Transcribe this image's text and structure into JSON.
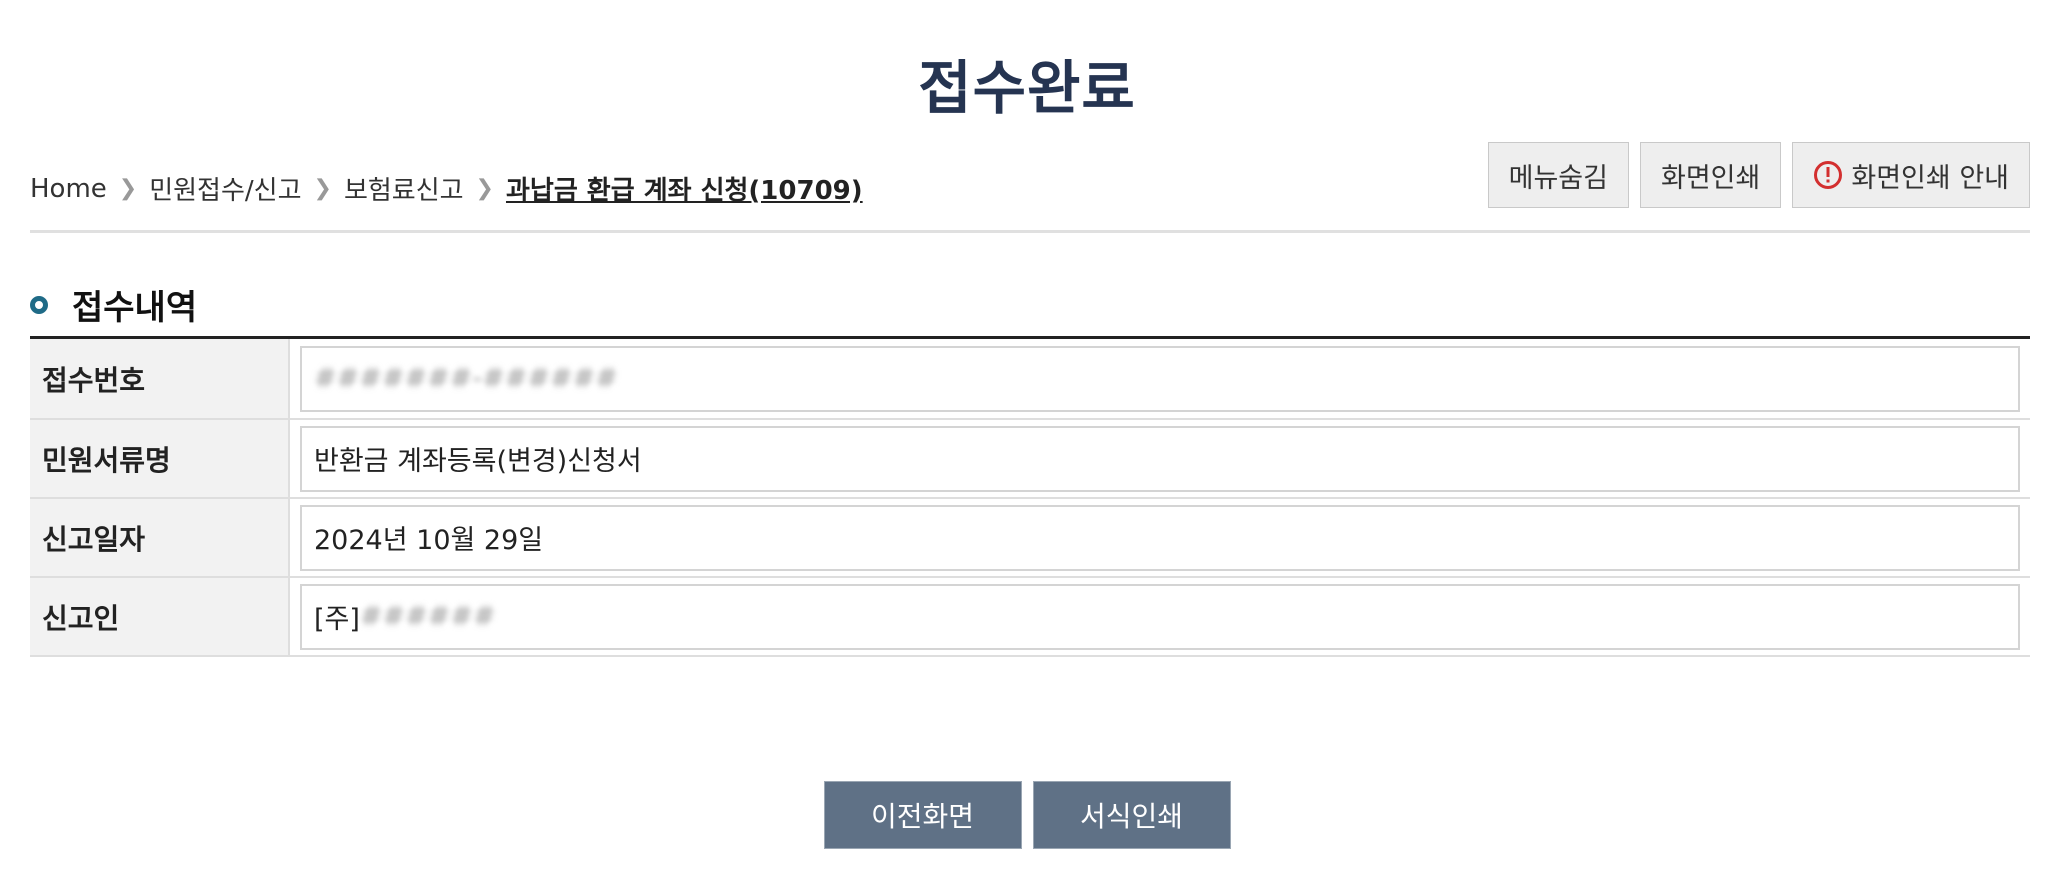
{
  "page": {
    "title": "접수완료"
  },
  "breadcrumb": {
    "items": [
      "Home",
      "민원접수/신고",
      "보험료신고"
    ],
    "current": "과납금 환급 계좌 신청(10709)"
  },
  "toolbar": {
    "hide_menu": "메뉴숨김",
    "print_screen": "화면인쇄",
    "print_guide": "화면인쇄 안내"
  },
  "section": {
    "title": "접수내역"
  },
  "receipt": {
    "rows": [
      {
        "label": "접수번호",
        "value": "#######-######",
        "masked": true
      },
      {
        "label": "민원서류명",
        "value": "반환금 계좌등록(변경)신청서"
      },
      {
        "label": "신고일자",
        "value": "2024년 10월 29일"
      },
      {
        "label": "신고인",
        "prefix": "[주]",
        "value": "######",
        "masked": true
      }
    ]
  },
  "actions": {
    "previous": "이전화면",
    "print_form": "서식인쇄"
  },
  "colors": {
    "title": "#253451",
    "action_button": "#5f7186",
    "bullet": "#1f6b87",
    "warning": "#d32f2f"
  },
  "icons": [
    "chevron-right-icon",
    "warning-circle-icon",
    "section-bullet-icon"
  ]
}
